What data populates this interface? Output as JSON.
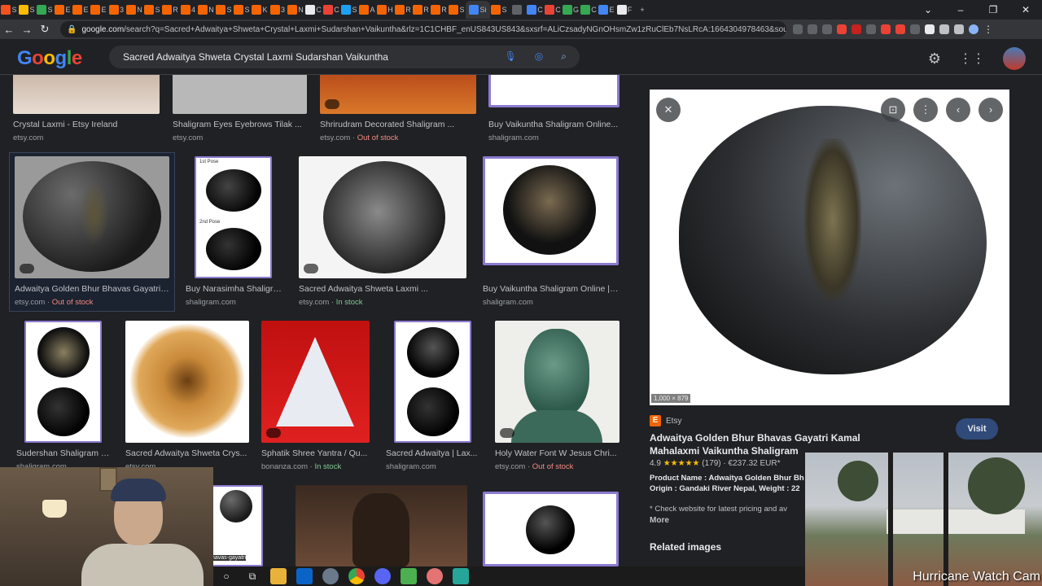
{
  "browser": {
    "tabs": [
      {
        "letter": "S",
        "color": "#f4511e"
      },
      {
        "letter": "S",
        "color": "#fbbc04"
      },
      {
        "letter": "S",
        "color": "#34a853"
      },
      {
        "letter": "E",
        "color": "#f56400"
      },
      {
        "letter": "E",
        "color": "#f56400"
      },
      {
        "letter": "E",
        "color": "#f56400"
      },
      {
        "letter": "3",
        "color": "#f56400"
      },
      {
        "letter": "N",
        "color": "#f56400"
      },
      {
        "letter": "S",
        "color": "#f56400"
      },
      {
        "letter": "R",
        "color": "#f56400"
      },
      {
        "letter": "4",
        "color": "#f56400"
      },
      {
        "letter": "N",
        "color": "#f56400"
      },
      {
        "letter": "S",
        "color": "#f56400"
      },
      {
        "letter": "S",
        "color": "#f56400"
      },
      {
        "letter": "K",
        "color": "#f56400"
      },
      {
        "letter": "3",
        "color": "#f56400"
      },
      {
        "letter": "N",
        "color": "#f56400"
      },
      {
        "letter": "C",
        "color": "#e8eaed"
      },
      {
        "letter": "C",
        "color": "#ea4335"
      },
      {
        "letter": "S",
        "color": "#1da1f2"
      },
      {
        "letter": "A",
        "color": "#f56400"
      },
      {
        "letter": "H",
        "color": "#f56400"
      },
      {
        "letter": "R",
        "color": "#f56400"
      },
      {
        "letter": "R",
        "color": "#f56400"
      },
      {
        "letter": "R",
        "color": "#f56400"
      },
      {
        "letter": "S",
        "color": "#f56400"
      },
      {
        "letter": "Si",
        "color": "#4285f4",
        "active": true
      },
      {
        "letter": "S",
        "color": "#f56400"
      },
      {
        "letter": "",
        "color": "#5f6368"
      },
      {
        "letter": "C",
        "color": "#4285f4"
      },
      {
        "letter": "C",
        "color": "#ea4335"
      },
      {
        "letter": "G",
        "color": "#34a853"
      },
      {
        "letter": "C",
        "color": "#34a853"
      },
      {
        "letter": "E",
        "color": "#4285f4"
      },
      {
        "letter": "F",
        "color": "#e8eaed"
      }
    ],
    "new_tab": "+",
    "url_host": "google.com",
    "url_path": "/search?q=Sacred+Adwaitya+Shweta+Crystal+Laxmi+Sudarshan+Vaikuntha&rlz=1C1CHBF_enUS843US843&sxsrf=ALiCzsadyNGnOHsmZw1zRuClEb7NsLRcA:1664304978463&source=lnms&tbm=is..."
  },
  "header": {
    "logo": "Google",
    "query": "Sacred Adwaitya Shweta Crystal Laxmi Sudarshan Vaikuntha"
  },
  "results": {
    "row1": [
      {
        "caption": "Crystal Laxmi - Etsy Ireland",
        "source": "etsy.com",
        "status": ""
      },
      {
        "caption": "Shaligram Eyes Eyebrows Tilak ...",
        "source": "etsy.com",
        "status": ""
      },
      {
        "caption": "Shrirudram Decorated Shaligram ...",
        "source": "etsy.com · ",
        "status": "Out of stock"
      },
      {
        "caption": "Buy Vaikuntha Shaligram Online...",
        "source": "shaligram.com",
        "status": ""
      }
    ],
    "row2": [
      {
        "caption": "Adwaitya Golden Bhur Bhavas Gayatri ...",
        "source": "etsy.com · ",
        "status": "Out of stock"
      },
      {
        "caption": "Buy Narasimha Shaligra...",
        "source": "shaligram.com",
        "status": ""
      },
      {
        "caption": "Sacred Adwaitya Shweta Laxmi ...",
        "source": "etsy.com · ",
        "status": "In stock"
      },
      {
        "caption": "Buy Vaikuntha Shaligram Online | ...",
        "source": "shaligram.com",
        "status": ""
      }
    ],
    "row3": [
      {
        "caption": "Sudershan Shaligram | ...",
        "source": "shaligram.com",
        "status": ""
      },
      {
        "caption": "Sacred Adwaitya Shweta Crys...",
        "source": "etsy.com",
        "status": ""
      },
      {
        "caption": "Sphatik Shree Yantra / Qu...",
        "source": "bonanza.com · ",
        "status": "In stock"
      },
      {
        "caption": "Sacred Adwaitya | Lax...",
        "source": "shaligram.com",
        "status": ""
      },
      {
        "caption": "Holy Water Font W Jesus Chri...",
        "source": "etsy.com · ",
        "status": "Out of stock"
      }
    ],
    "pose1": "1st Pose",
    "pose2": "2nd Pose",
    "partial_label": "havas-gayatri"
  },
  "preview": {
    "dims": "1,000 × 879",
    "source": "Etsy",
    "visit": "Visit",
    "title": "Adwaitya Golden Bhur Bhavas Gayatri Kamal Mahalaxmi Vaikuntha Shaligram",
    "rating_value": "4.9",
    "stars": "★★★★★",
    "rating_count": "(179)",
    "price": "€237.32 EUR*",
    "desc_line1": "Product Name : Adwaitya Golden Bhur Bh",
    "desc_line2": "Origin : Gandaki River Nepal, Weight : 22",
    "check": "* Check website for latest pricing and av",
    "more": "More",
    "related": "Related images"
  },
  "overlay": {
    "hurricane_label": "Hurricane Watch Cam"
  },
  "colors": {
    "google_blue": "#4285f4",
    "google_red": "#ea4335",
    "google_yellow": "#fbbc04",
    "google_green": "#34a853",
    "out_of_stock": "#f28b82",
    "in_stock": "#81c995"
  }
}
